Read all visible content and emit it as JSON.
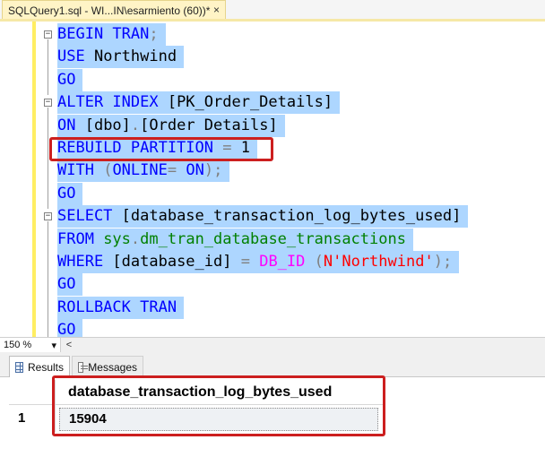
{
  "tab": {
    "title": "SQLQuery1.sql - WI...IN\\esarmiento (60))*",
    "close": "×"
  },
  "code": {
    "lines": [
      {
        "parts": [
          {
            "t": "BEGIN TRAN",
            "c": "kw"
          },
          {
            "t": ";",
            "c": "gray"
          }
        ],
        "fold": "−"
      },
      {
        "parts": [
          {
            "t": "USE ",
            "c": "kw"
          },
          {
            "t": "Northwind",
            "c": "id"
          }
        ]
      },
      {
        "parts": [
          {
            "t": "GO",
            "c": "kw"
          }
        ]
      },
      {
        "parts": [
          {
            "t": "ALTER INDEX ",
            "c": "kw"
          },
          {
            "t": "[PK_Order_Details]",
            "c": "id"
          }
        ],
        "fold": "−"
      },
      {
        "parts": [
          {
            "t": "ON ",
            "c": "kw"
          },
          {
            "t": "[dbo]",
            "c": "id"
          },
          {
            "t": ".",
            "c": "gray"
          },
          {
            "t": "[Order Details]",
            "c": "id"
          }
        ]
      },
      {
        "parts": [
          {
            "t": "REBUILD PARTITION ",
            "c": "kw"
          },
          {
            "t": "= ",
            "c": "gray"
          },
          {
            "t": "1",
            "c": "id"
          }
        ]
      },
      {
        "parts": [
          {
            "t": "WITH ",
            "c": "kw"
          },
          {
            "t": "(",
            "c": "gray"
          },
          {
            "t": "ONLINE",
            "c": "kw"
          },
          {
            "t": "= ",
            "c": "gray"
          },
          {
            "t": "ON",
            "c": "kw"
          },
          {
            "t": ");",
            "c": "gray"
          }
        ]
      },
      {
        "parts": [
          {
            "t": "GO",
            "c": "kw"
          }
        ]
      },
      {
        "parts": [
          {
            "t": "SELECT ",
            "c": "kw"
          },
          {
            "t": "[database_transaction_log_bytes_used]",
            "c": "id"
          }
        ],
        "fold": "−"
      },
      {
        "parts": [
          {
            "t": "FROM ",
            "c": "kw"
          },
          {
            "t": "sys",
            "c": "sys"
          },
          {
            "t": ".",
            "c": "gray"
          },
          {
            "t": "dm_tran_database_transactions",
            "c": "sys"
          }
        ]
      },
      {
        "parts": [
          {
            "t": "WHERE ",
            "c": "kw"
          },
          {
            "t": "[database_id] ",
            "c": "id"
          },
          {
            "t": "= ",
            "c": "gray"
          },
          {
            "t": "DB_ID ",
            "c": "fn"
          },
          {
            "t": "(",
            "c": "gray"
          },
          {
            "t": "N'Northwind'",
            "c": "str"
          },
          {
            "t": ");",
            "c": "gray"
          }
        ]
      },
      {
        "parts": [
          {
            "t": "GO",
            "c": "kw"
          }
        ]
      },
      {
        "parts": [
          {
            "t": "ROLLBACK TRAN",
            "c": "kw"
          }
        ]
      },
      {
        "parts": [
          {
            "t": "GO",
            "c": "kw"
          }
        ]
      }
    ]
  },
  "statusbar": {
    "zoom": "150 %",
    "zoom_arrow": "▾",
    "scroll_left": "<"
  },
  "results_tabs": {
    "results_label": "Results",
    "messages_label": "Messages"
  },
  "grid": {
    "column": "database_transaction_log_bytes_used",
    "row_number": "1",
    "value": "15904"
  }
}
